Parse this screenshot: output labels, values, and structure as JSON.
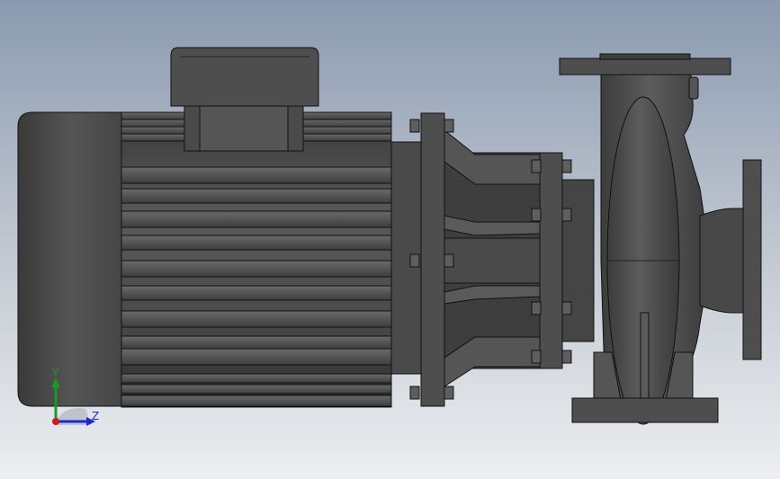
{
  "viewport": {
    "background_top": "#8b9ab0",
    "background_bottom": "#eceef0"
  },
  "model": {
    "subject": "pump-motor-assembly",
    "body_color": "#4a4a4a",
    "edge_color": "#111111",
    "highlight_color": "#6a6a6a"
  },
  "triad": {
    "y_label": "Y",
    "z_label": "Z",
    "y_color": "#1a9a2a",
    "z_color": "#1a2ad0",
    "origin_color": "#c81e1e"
  }
}
